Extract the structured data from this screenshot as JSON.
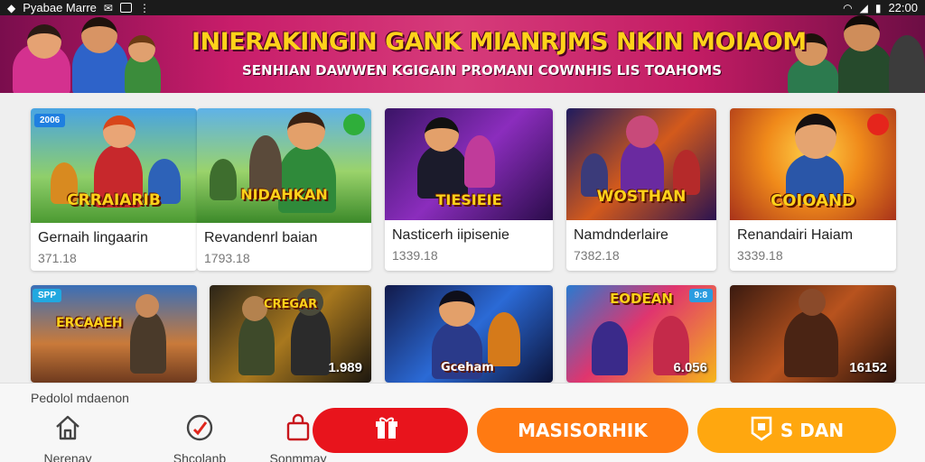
{
  "status_bar": {
    "app_name": "Pyabae Marre",
    "time": "22:00"
  },
  "banner": {
    "title": "INIERAKINGIN GANK MIANRJMS NKIN MOIAOM",
    "subtitle": "SENHIAN DAWWEN KGIGAIN PROMANI COWNHIS LIS TOAHOMS"
  },
  "games": [
    {
      "name": "Gernaih lingaarin",
      "meta": "371.18",
      "art_title": "CRRAIARIB",
      "tag": "2006"
    },
    {
      "name": "Revandenrl baian",
      "meta": "1793.18",
      "art_title": "NIDAHKAN"
    },
    {
      "name": "Nasticerh iipisenie",
      "meta": "1339.18",
      "art_title": "TIESIEIE"
    },
    {
      "name": "Namdnderlaire",
      "meta": "7382.18",
      "art_title": "WOSTHAN"
    },
    {
      "name": "Renandairi Haiam",
      "meta": "3339.18",
      "art_title": "COIOAND"
    }
  ],
  "row2": [
    {
      "tag": "SPP",
      "art_title": "ERCAAEH"
    },
    {
      "count": "1.989",
      "art_title": "CREGAR"
    },
    {
      "art_title": "Gceham"
    },
    {
      "tag": "9:8",
      "count": "6.056",
      "art_title": "EODEAN"
    },
    {
      "count": "16152"
    }
  ],
  "bottom": {
    "caption": "Pedolol mdaenon",
    "nav": [
      {
        "label": "Nerenay",
        "icon": "home-icon"
      },
      {
        "label": "Shcolanb",
        "icon": "compass-icon"
      },
      {
        "label": "Sonmmay",
        "icon": "bag-icon"
      }
    ],
    "buttons": [
      {
        "label": "",
        "icon": "gift-icon",
        "color": "#e8141c"
      },
      {
        "label": "MASISORHIK",
        "color": "#ff7a12"
      },
      {
        "label": "S DAN",
        "icon": "badge-icon",
        "color": "#ffa70f"
      }
    ]
  },
  "colors": {
    "banner": "#c81d6a",
    "accent_red": "#e8141c",
    "accent_orange": "#ff7a12",
    "accent_yellow": "#ffa70f",
    "title_gold": "#ffd21a"
  }
}
